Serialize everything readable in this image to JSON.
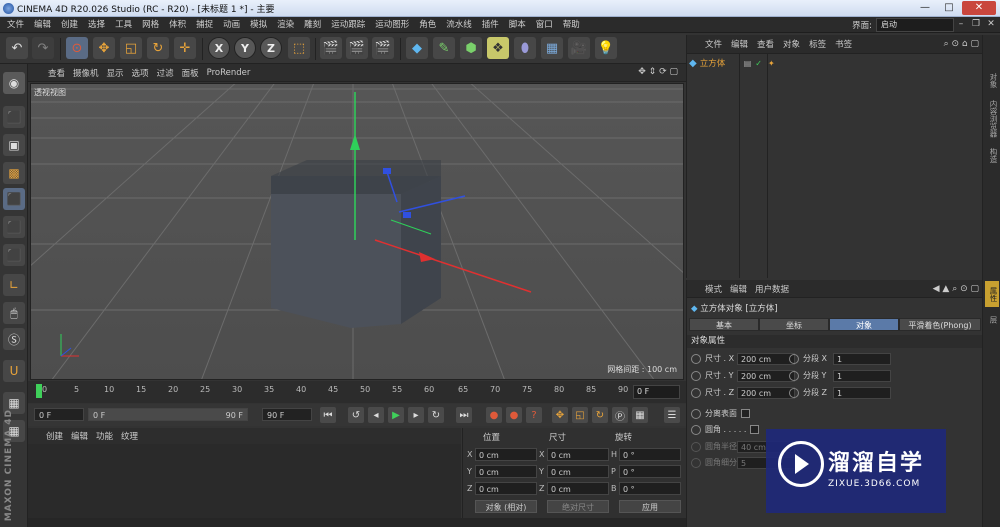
{
  "window": {
    "title": "CINEMA 4D R20.026 Studio (RC - R20) - [未标题 1 *] - 主要",
    "min": "—",
    "max": "□",
    "close": "✕"
  },
  "menu": [
    "文件",
    "编辑",
    "创建",
    "选择",
    "工具",
    "网格",
    "体积",
    "捕捉",
    "动画",
    "模拟",
    "渲染",
    "雕刻",
    "运动跟踪",
    "运动图形",
    "角色",
    "流水线",
    "插件",
    "脚本",
    "窗口",
    "帮助"
  ],
  "layout": {
    "label": "界面:",
    "value": "启动"
  },
  "viewport": {
    "menu": [
      "查看",
      "摄像机",
      "显示",
      "选项",
      "过滤",
      "面板",
      "ProRender"
    ],
    "label": "透视视图",
    "grid_info": "网格间距 : 100 cm"
  },
  "timeline": {
    "ticks": [
      "0",
      "5",
      "10",
      "15",
      "20",
      "25",
      "30",
      "35",
      "40",
      "45",
      "50",
      "55",
      "60",
      "65",
      "70",
      "75",
      "80",
      "85",
      "90"
    ],
    "frame_field": "0 F"
  },
  "transport": {
    "start": "0 F",
    "range_start": "0 F",
    "range_end": "90 F",
    "end": "90 F"
  },
  "material": {
    "menu": [
      "创建",
      "编辑",
      "功能",
      "纹理"
    ]
  },
  "coords": {
    "headers": [
      "位置",
      "尺寸",
      "旋转"
    ],
    "rows": [
      {
        "axis": "X",
        "pos": "0 cm",
        "size_axis": "X",
        "size": "0 cm",
        "rot_axis": "H",
        "rot": "0 °"
      },
      {
        "axis": "Y",
        "pos": "0 cm",
        "size_axis": "Y",
        "size": "0 cm",
        "rot_axis": "P",
        "rot": "0 °"
      },
      {
        "axis": "Z",
        "pos": "0 cm",
        "size_axis": "Z",
        "size": "0 cm",
        "rot_axis": "B",
        "rot": "0 °"
      }
    ],
    "mode": "对象 (相对)",
    "size_mode": "绝对尺寸",
    "apply": "应用"
  },
  "objects": {
    "menu": [
      "文件",
      "编辑",
      "查看",
      "对象",
      "标签",
      "书签"
    ],
    "items": [
      {
        "name": "立方体"
      }
    ]
  },
  "attributes": {
    "menu": [
      "模式",
      "编辑",
      "用户数据"
    ],
    "title": "立方体对象 [立方体]",
    "tabs": [
      "基本",
      "坐标",
      "对象",
      "平滑着色(Phong)"
    ],
    "active_tab": "对象",
    "section": "对象属性",
    "size": [
      {
        "label": "尺寸 . X",
        "value": "200 cm",
        "seg_label": "分段 X",
        "seg": "1"
      },
      {
        "label": "尺寸 . Y",
        "value": "200 cm",
        "seg_label": "分段 Y",
        "seg": "1"
      },
      {
        "label": "尺寸 . Z",
        "value": "200 cm",
        "seg_label": "分段 Z",
        "seg": "1"
      }
    ],
    "separate": "分离表面",
    "fillet": "圆角 . . . . .",
    "fillet_radius": {
      "label": "圆角半径",
      "value": "40 cm"
    },
    "fillet_sub": {
      "label": "圆角细分",
      "value": "5"
    }
  },
  "side_tabs": [
    "对象",
    "内容浏览器",
    "构造",
    "属性",
    "层"
  ],
  "left_brand": "MAXON CINEMA 4D",
  "watermark": {
    "title": "溜溜自学",
    "url": "ZIXUE.3D66.COM"
  }
}
